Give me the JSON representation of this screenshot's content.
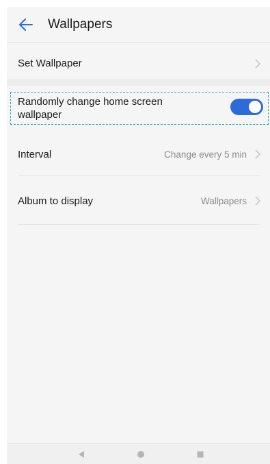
{
  "header": {
    "title": "Wallpapers",
    "back_icon": "arrow-left-icon",
    "accent_color": "#2f6bd8"
  },
  "settings": {
    "set_wallpaper": {
      "label": "Set Wallpaper"
    },
    "random_change": {
      "label": "Randomly change home screen wallpaper",
      "enabled": true
    },
    "interval": {
      "label": "Interval",
      "value": "Change every 5 min"
    },
    "album": {
      "label": "Album to display",
      "value": "Wallpapers"
    }
  },
  "navbar": {
    "back": "triangle-back-icon",
    "home": "circle-home-icon",
    "recent": "square-recent-icon"
  }
}
